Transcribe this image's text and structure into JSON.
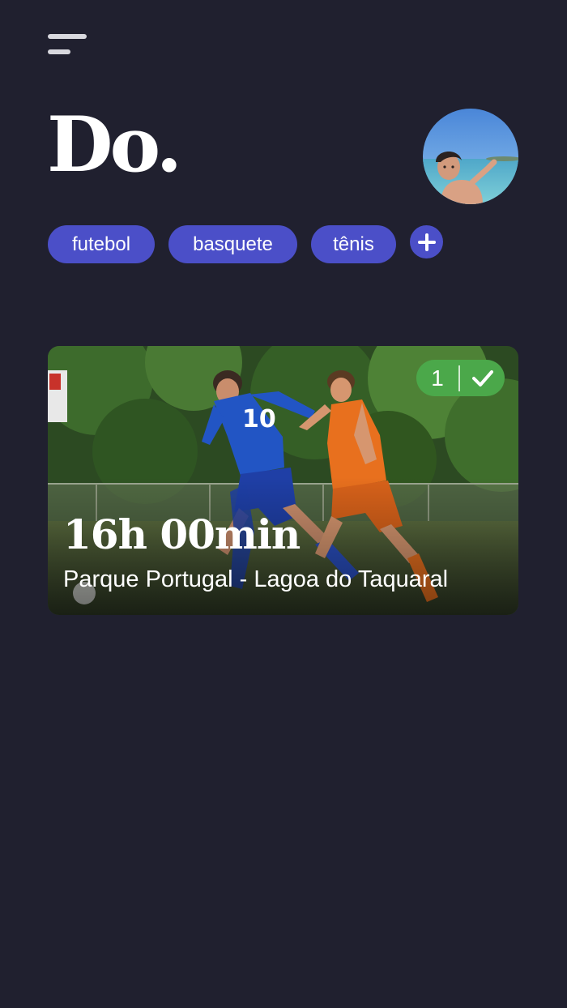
{
  "app": {
    "logo": "Do."
  },
  "menu": {
    "icon": "hamburger-menu-icon"
  },
  "profile": {
    "avatar_icon": "user-avatar-photo"
  },
  "categories": {
    "items": [
      {
        "label": "futebol"
      },
      {
        "label": "basquete"
      },
      {
        "label": "tênis"
      }
    ],
    "add_icon": "plus-icon"
  },
  "event": {
    "time": "16h 00min",
    "location": "Parque Portugal - Lagoa do Taquaral",
    "confirmed_count": "1",
    "confirmed_icon": "checkmark-icon",
    "image": "soccer-players-photo"
  },
  "colors": {
    "background": "#20202f",
    "chip": "#4b4fc8",
    "confirm_badge": "#4ba84a",
    "text": "#ffffff"
  }
}
